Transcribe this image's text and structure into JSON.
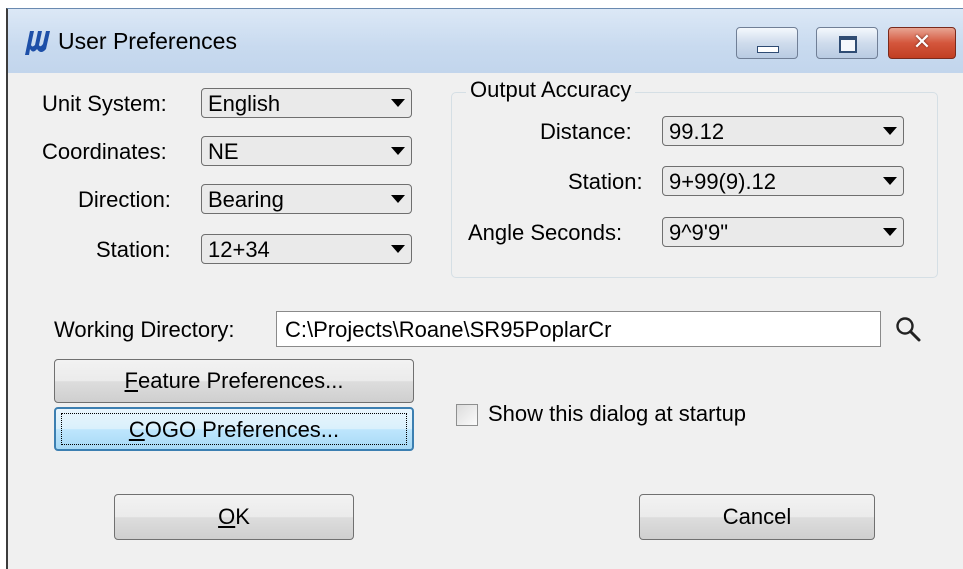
{
  "window": {
    "title": "User Preferences",
    "close_glyph": "✕"
  },
  "settings": {
    "unit_system": {
      "label": "Unit System:",
      "value": "English"
    },
    "coordinates": {
      "label": "Coordinates:",
      "value": "NE"
    },
    "direction": {
      "label": "Direction:",
      "value": "Bearing"
    },
    "station": {
      "label": "Station:",
      "value": "12+34"
    }
  },
  "output_accuracy": {
    "title": "Output Accuracy",
    "distance": {
      "label": "Distance:",
      "value": "99.12"
    },
    "station": {
      "label": "Station:",
      "value": "9+99(9).12"
    },
    "angle_seconds": {
      "label": "Angle Seconds:",
      "value": "9^9'9\""
    }
  },
  "working_directory": {
    "label": "Working Directory:",
    "value": "C:\\Projects\\Roane\\SR95PoplarCr"
  },
  "buttons": {
    "feature_prefs": {
      "mnemonic": "F",
      "rest": "eature Preferences..."
    },
    "cogo_prefs": {
      "mnemonic": "C",
      "rest": "OGO Preferences..."
    },
    "ok": {
      "mnemonic": "O",
      "rest": "K"
    },
    "cancel": "Cancel"
  },
  "startup_checkbox": {
    "label": "Show this dialog at startup",
    "checked": false
  },
  "icons": [
    "app-logo-icon",
    "minimize-icon",
    "maximize-icon",
    "close-icon",
    "search-icon",
    "dropdown-arrow-icon"
  ]
}
